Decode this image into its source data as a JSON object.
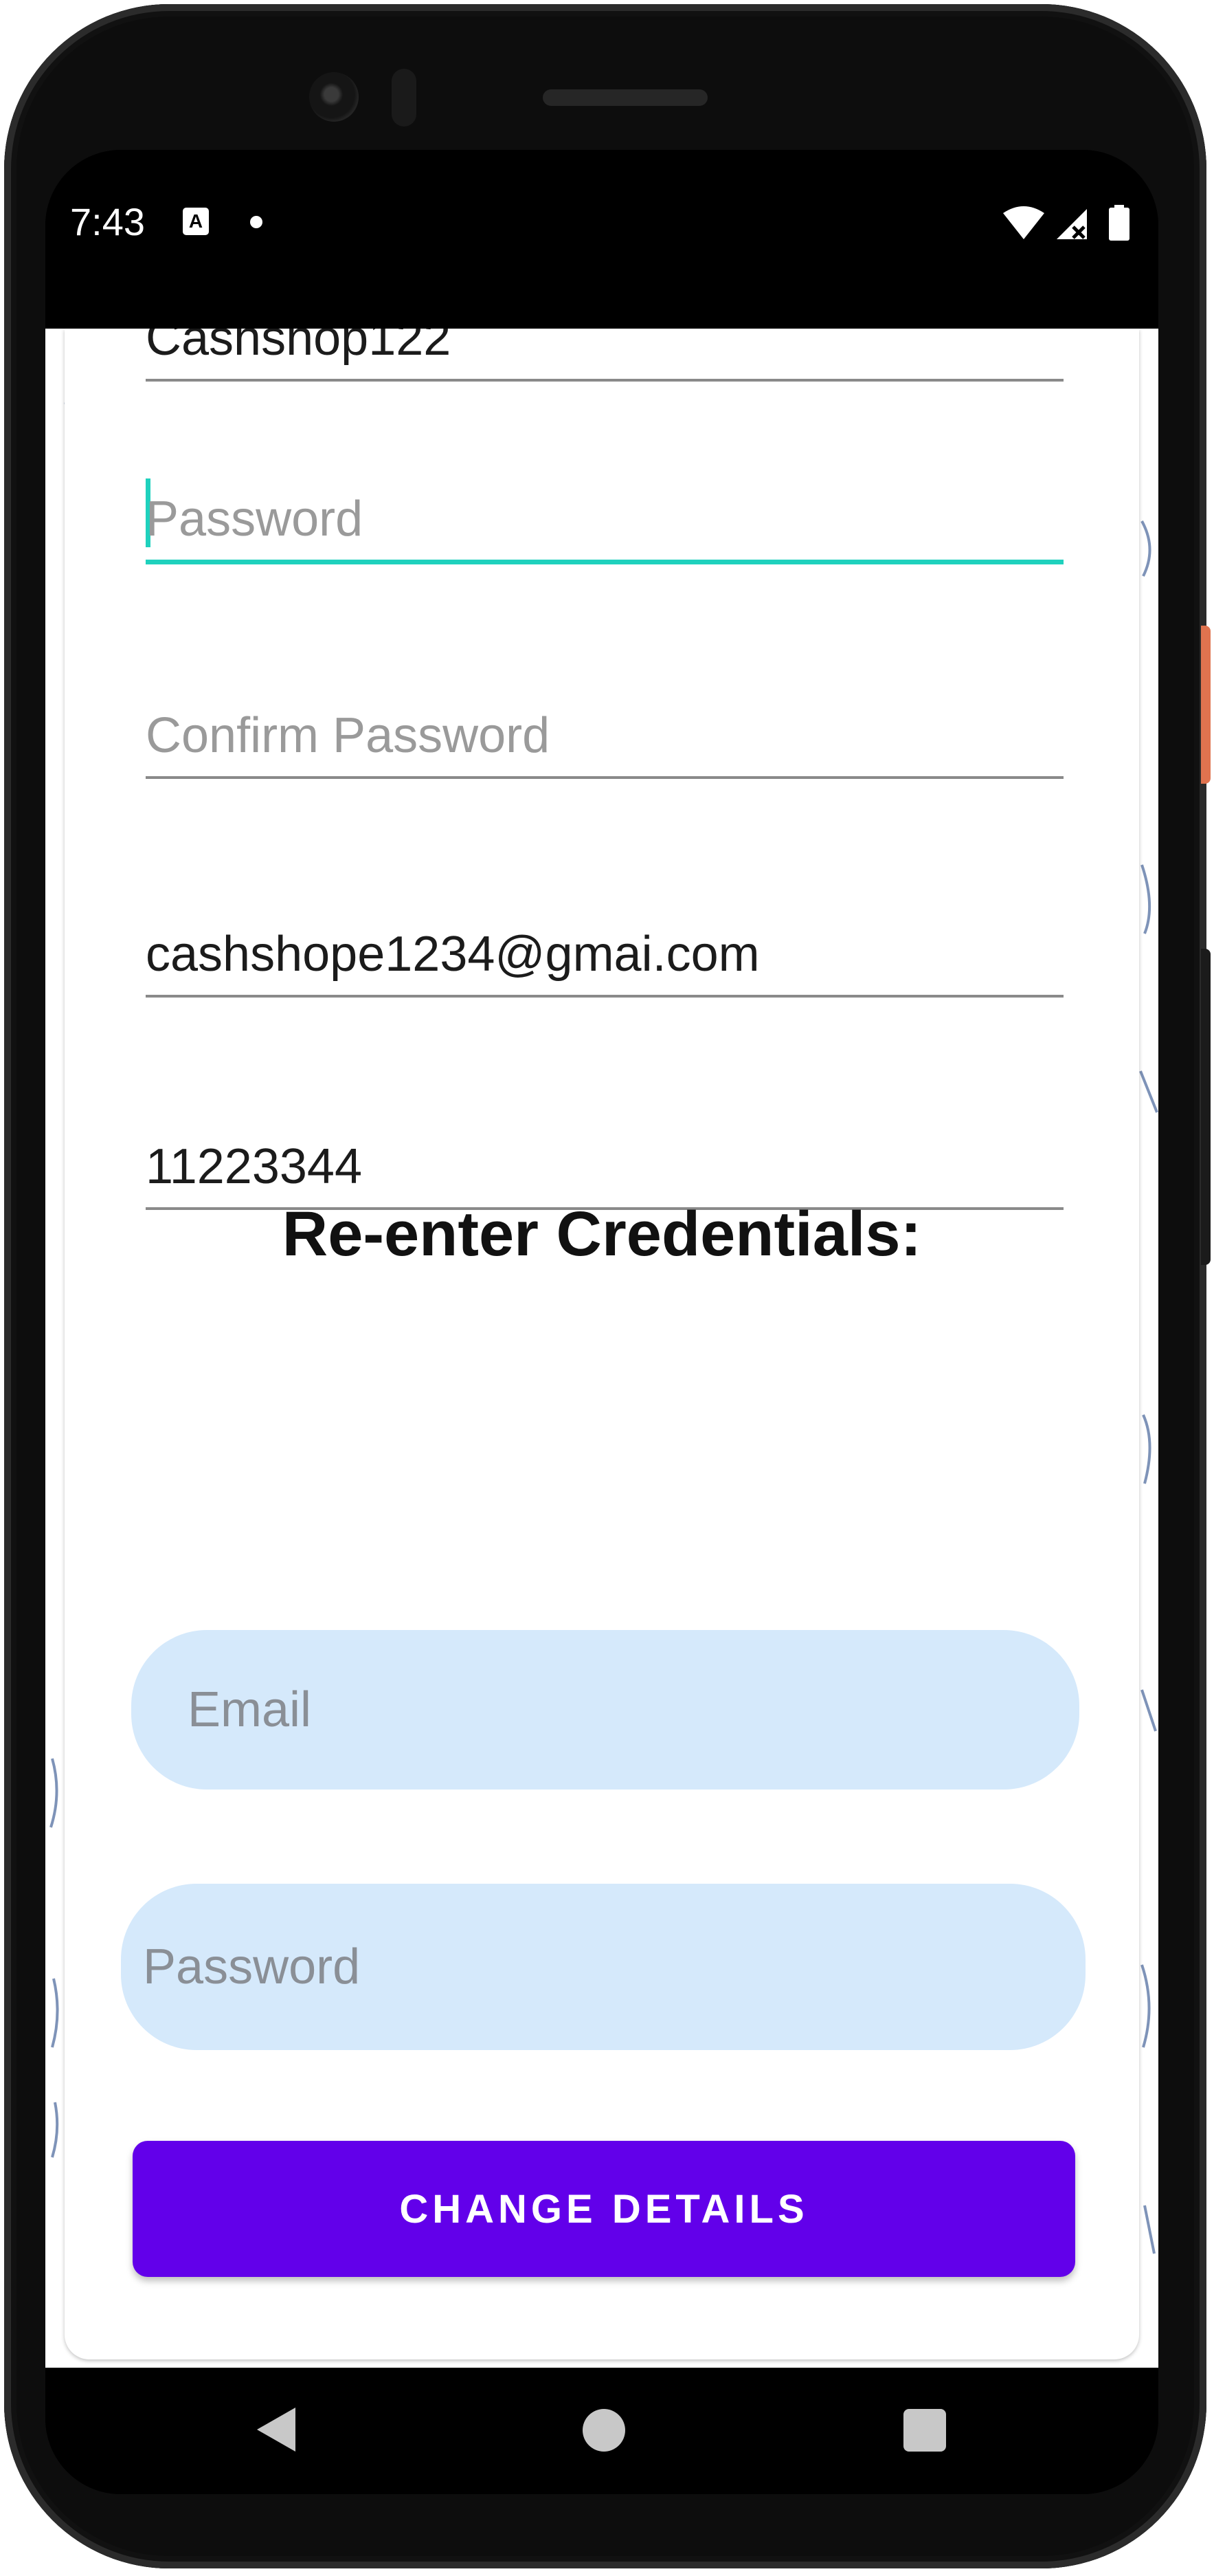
{
  "status_bar": {
    "time": "7:43",
    "notification_icon": "A"
  },
  "form": {
    "username_value": "Cashshop122",
    "password_placeholder": "Password",
    "confirm_password_placeholder": "Confirm Password",
    "email_value": "cashshope1234@gmai.com",
    "phone_value": "11223344"
  },
  "reenter": {
    "heading": "Re-enter Credentials:",
    "email_placeholder": "Email",
    "password_placeholder": "Password"
  },
  "actions": {
    "change_details_label": "CHANGE DETAILS"
  },
  "colors": {
    "accent_teal": "#1fd1bd",
    "primary_purple": "#6200ea",
    "pill_background": "#d5e9fb"
  },
  "icons": {
    "status": [
      "wifi-icon",
      "cellular-no-signal-icon",
      "battery-icon"
    ],
    "navigation": [
      "back-icon",
      "home-icon",
      "recents-icon"
    ]
  }
}
